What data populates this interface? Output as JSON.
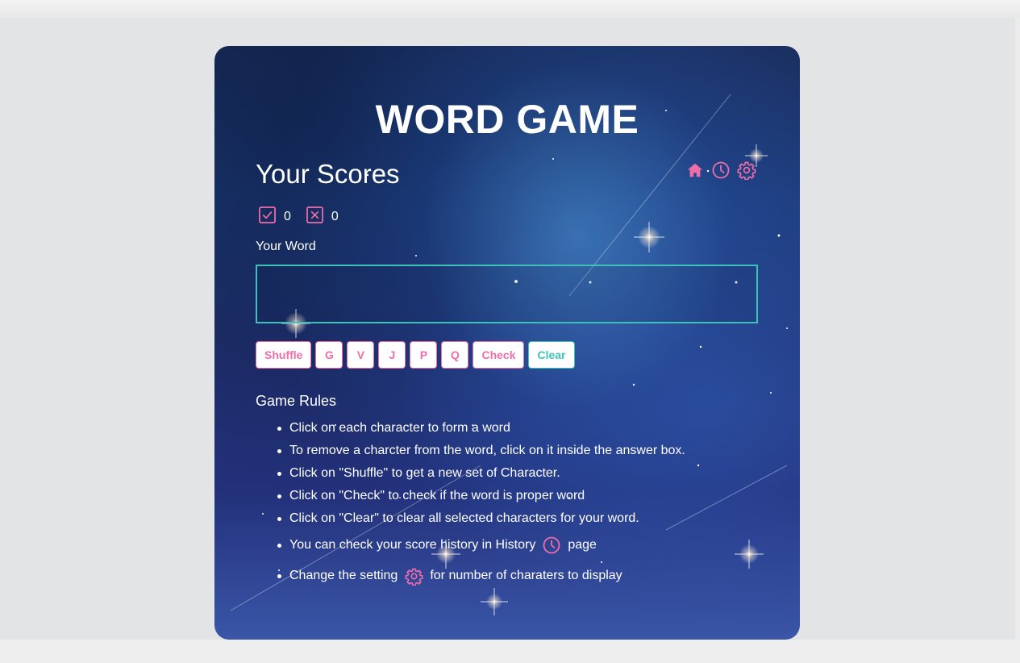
{
  "title": "WORD GAME",
  "scores": {
    "heading": "Your Scores",
    "correct": "0",
    "wrong": "0"
  },
  "nav": {
    "home_icon": "home-icon",
    "history_icon": "clock-icon",
    "settings_icon": "gear-icon"
  },
  "word": {
    "label": "Your Word",
    "value": ""
  },
  "buttons": {
    "shuffle": "Shuffle",
    "letters": [
      "G",
      "V",
      "J",
      "P",
      "Q"
    ],
    "check": "Check",
    "clear": "Clear"
  },
  "rules": {
    "heading": "Game Rules",
    "items": [
      "Click on each character to form a word",
      "To remove a charcter from the word, click on it inside the answer box.",
      "Click on \"Shuffle\" to get a new set of Character.",
      "Click on \"Check\" to check if the word is proper word",
      "Click on \"Clear\" to clear all selected characters for your word."
    ],
    "history_before": "You can check your score history in History",
    "history_after": "page",
    "settings_before": "Change the setting",
    "settings_after": "for number of charaters to display"
  },
  "colors": {
    "accent_pink": "#f06ea8",
    "accent_teal": "#3fc1bb",
    "page_bg": "#e3e4e6"
  }
}
